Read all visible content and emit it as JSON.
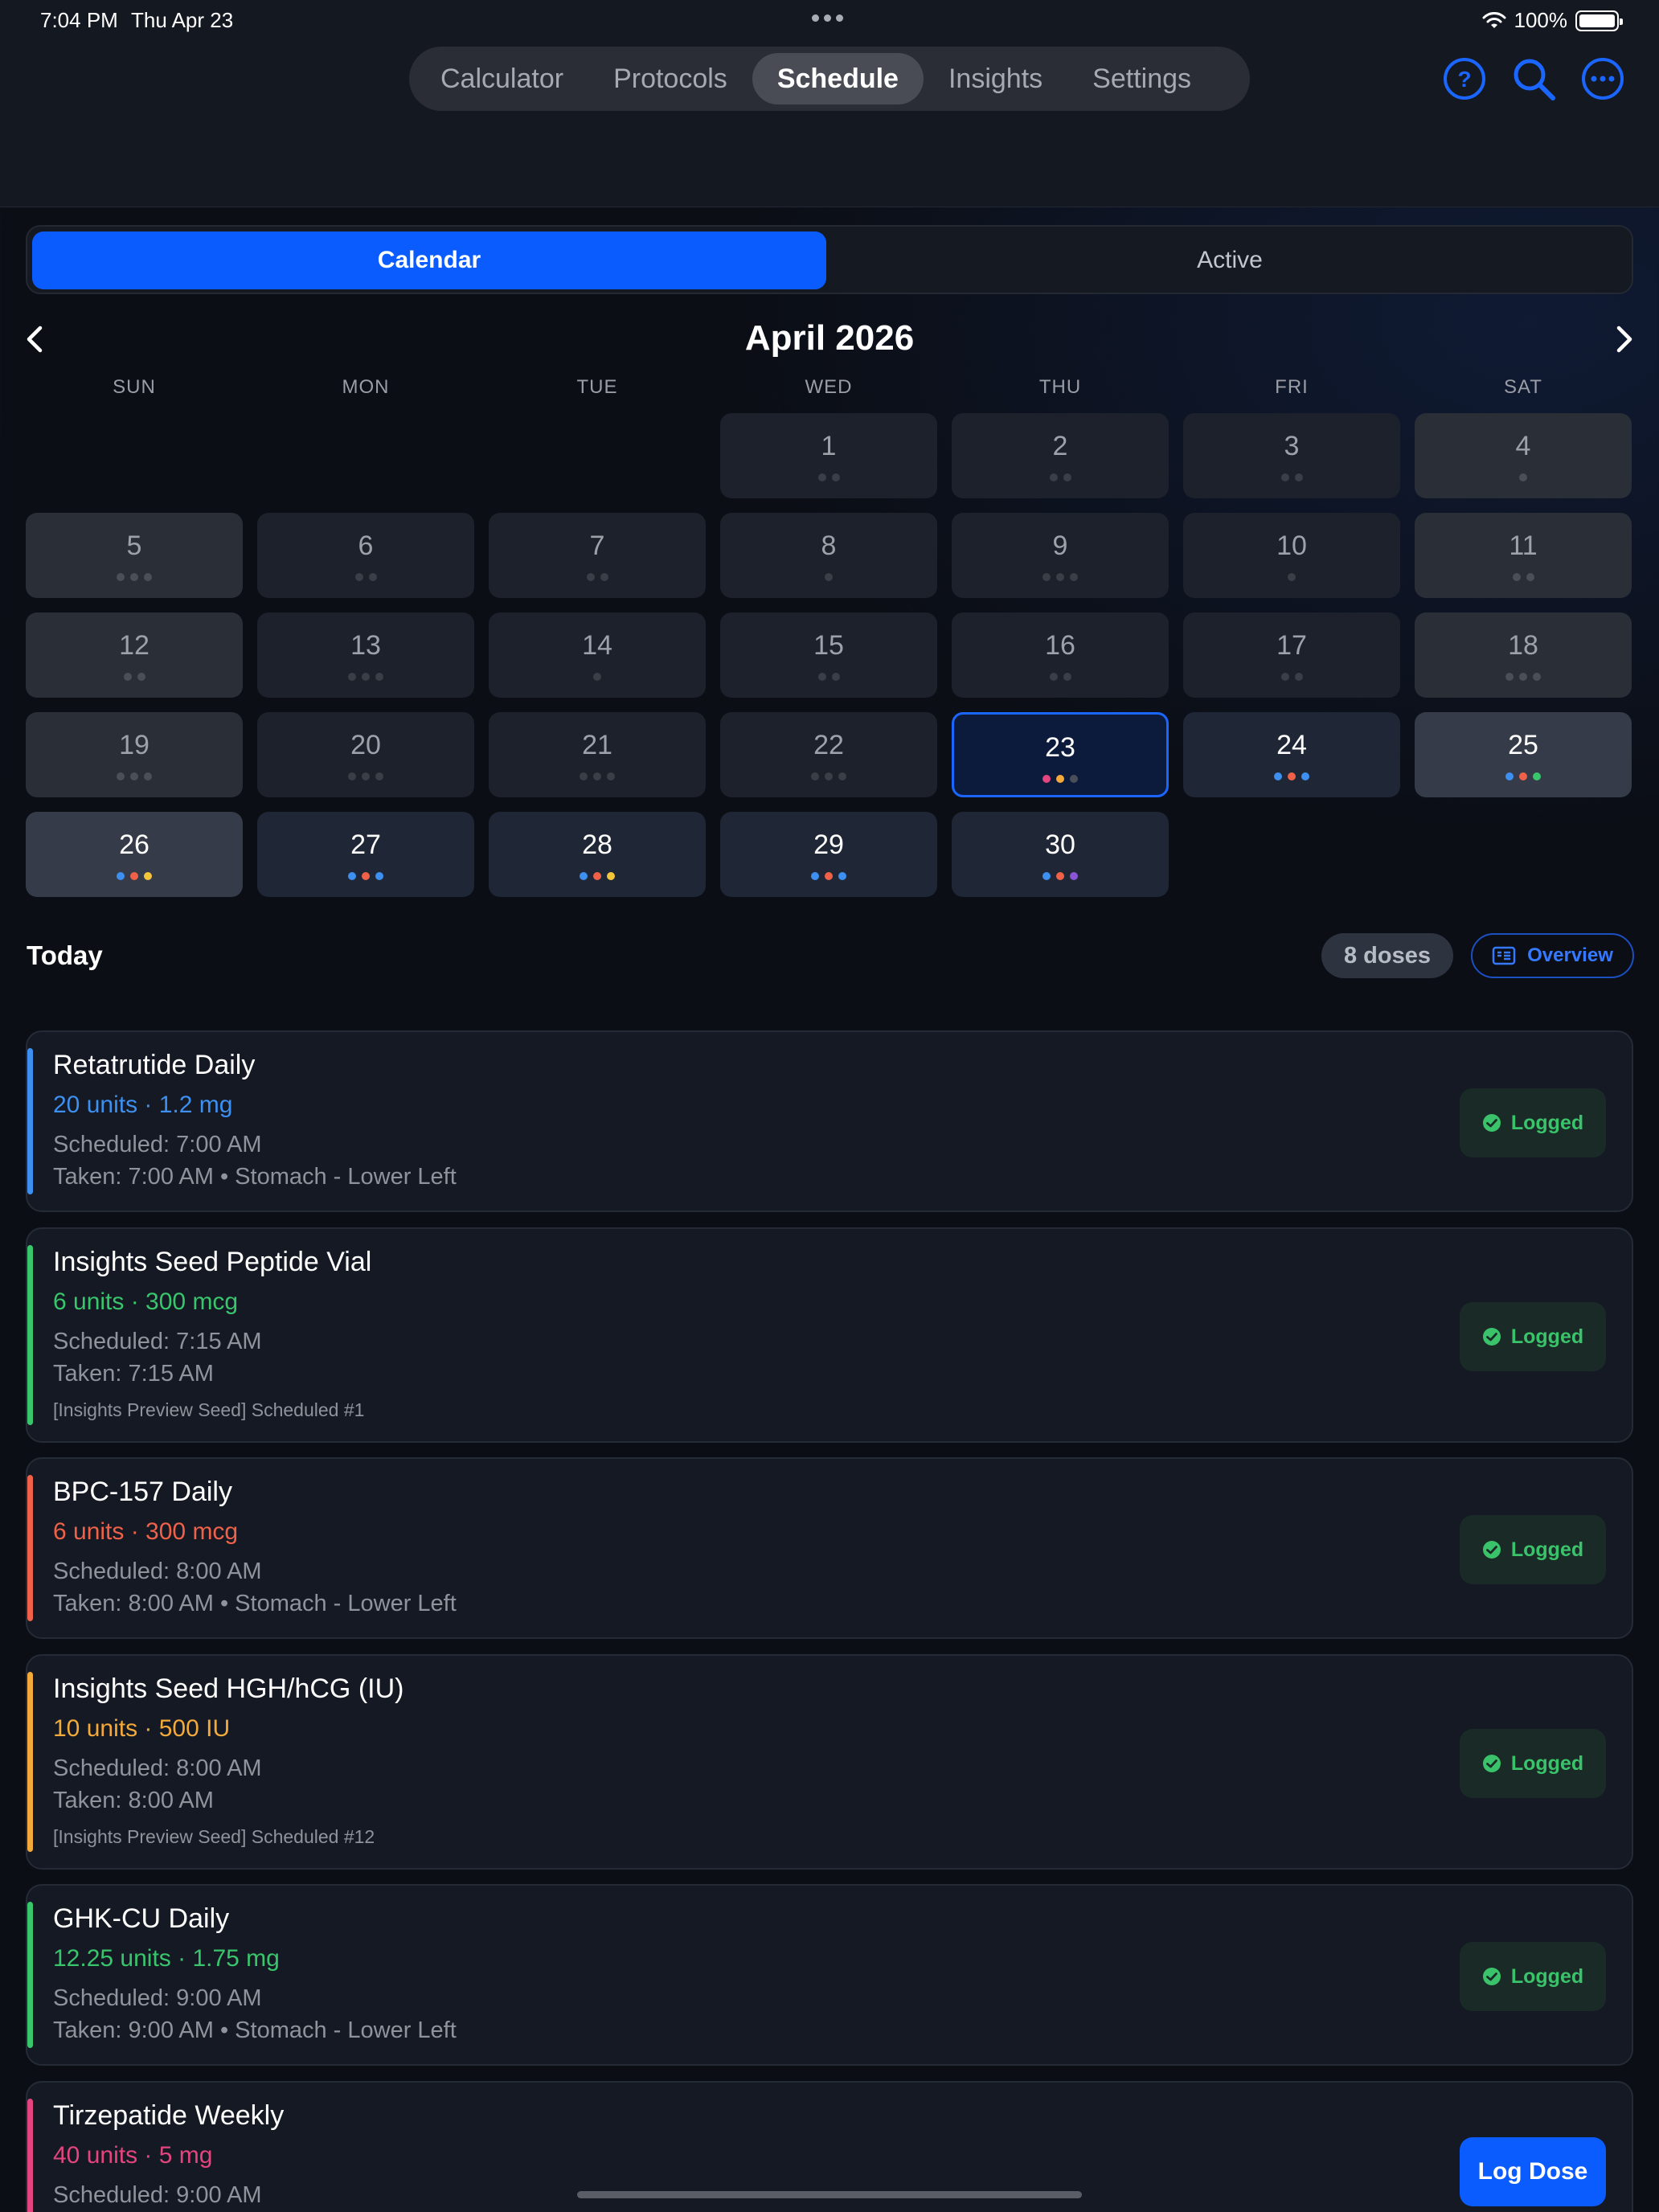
{
  "status_bar": {
    "time": "7:04 PM",
    "date": "Thu Apr 23",
    "battery": "100%",
    "battery_level": 1.0
  },
  "nav": {
    "tabs": [
      {
        "label": "Calculator",
        "active": false
      },
      {
        "label": "Protocols",
        "active": false
      },
      {
        "label": "Schedule",
        "active": true
      },
      {
        "label": "Insights",
        "active": false
      },
      {
        "label": "Settings",
        "active": false
      }
    ],
    "icons": [
      "help-icon",
      "search-icon",
      "more-icon"
    ],
    "accent": "#0a5cff"
  },
  "segment": {
    "calendar": "Calendar",
    "active": "Active",
    "selected": "Calendar"
  },
  "calendar": {
    "month_title": "April 2026",
    "weekdays": [
      "SUN",
      "MON",
      "TUE",
      "WED",
      "THU",
      "FRI",
      "SAT"
    ],
    "today": "23",
    "days": [
      {
        "day": "1",
        "dots": [
          "#3a3e47",
          "#3a3e47"
        ]
      },
      {
        "day": "2",
        "dots": [
          "#3a3e47",
          "#3a3e47"
        ]
      },
      {
        "day": "3",
        "dots": [
          "#3a3e47",
          "#3a3e47"
        ]
      },
      {
        "day": "4",
        "dots": [
          "#4b4f59"
        ]
      },
      {
        "day": "5",
        "dots": [
          "#4b4f59",
          "#4b4f59",
          "#4b4f59"
        ]
      },
      {
        "day": "6",
        "dots": [
          "#3a3e47",
          "#3a3e47"
        ]
      },
      {
        "day": "7",
        "dots": [
          "#3a3e47",
          "#3a3e47"
        ]
      },
      {
        "day": "8",
        "dots": [
          "#3a3e47"
        ]
      },
      {
        "day": "9",
        "dots": [
          "#3a3e47",
          "#3a3e47",
          "#3a3e47"
        ]
      },
      {
        "day": "10",
        "dots": [
          "#3a3e47"
        ]
      },
      {
        "day": "11",
        "dots": [
          "#4b4f59",
          "#4b4f59"
        ]
      },
      {
        "day": "12",
        "dots": [
          "#4b4f59",
          "#4b4f59"
        ]
      },
      {
        "day": "13",
        "dots": [
          "#3a3e47",
          "#3a3e47",
          "#3a3e47"
        ]
      },
      {
        "day": "14",
        "dots": [
          "#3a3e47"
        ]
      },
      {
        "day": "15",
        "dots": [
          "#3a3e47",
          "#3a3e47"
        ]
      },
      {
        "day": "16",
        "dots": [
          "#3a3e47",
          "#3a3e47"
        ]
      },
      {
        "day": "17",
        "dots": [
          "#3a3e47",
          "#3a3e47"
        ]
      },
      {
        "day": "18",
        "dots": [
          "#4b4f59",
          "#4b4f59",
          "#4b4f59"
        ]
      },
      {
        "day": "19",
        "dots": [
          "#4b4f59",
          "#4b4f59",
          "#4b4f59"
        ]
      },
      {
        "day": "20",
        "dots": [
          "#3a3e47",
          "#3a3e47",
          "#3a3e47"
        ]
      },
      {
        "day": "21",
        "dots": [
          "#3a3e47",
          "#3a3e47",
          "#3a3e47"
        ]
      },
      {
        "day": "22",
        "dots": [
          "#3a3e47",
          "#3a3e47",
          "#3a3e47"
        ]
      },
      {
        "day": "23",
        "dots": [
          "#e5457e",
          "#f4a93b",
          "#4a4e58"
        ]
      },
      {
        "day": "24",
        "dots": [
          "#3d8ff0",
          "#ef6148",
          "#3d8ff0"
        ]
      },
      {
        "day": "25",
        "dots": [
          "#3d8ff0",
          "#ef6148",
          "#39c56c"
        ]
      },
      {
        "day": "26",
        "dots": [
          "#3d8ff0",
          "#ef6148",
          "#f4c43b"
        ]
      },
      {
        "day": "27",
        "dots": [
          "#3d8ff0",
          "#ef6148",
          "#3d8ff0"
        ]
      },
      {
        "day": "28",
        "dots": [
          "#3d8ff0",
          "#ef6148",
          "#f4c43b"
        ]
      },
      {
        "day": "29",
        "dots": [
          "#3d8ff0",
          "#ef6148",
          "#3d8ff0"
        ]
      },
      {
        "day": "30",
        "dots": [
          "#3d8ff0",
          "#ef6148",
          "#8a55d6"
        ]
      }
    ]
  },
  "today_section": {
    "title": "Today",
    "dose_count": "8 doses",
    "overview_label": "Overview"
  },
  "doses": [
    {
      "name": "Retatrutide Daily",
      "dose": "20 units · 1.2 mg",
      "color": "#3d8ff0",
      "scheduled": "Scheduled: 7:00 AM",
      "taken": "Taken: 7:00 AM • Stomach - Lower Left",
      "note": "",
      "status": "Logged"
    },
    {
      "name": "Insights Seed Peptide Vial",
      "dose": "6 units · 300 mcg",
      "color": "#39c56c",
      "scheduled": "Scheduled: 7:15 AM",
      "taken": "Taken: 7:15 AM",
      "note": "[Insights Preview Seed] Scheduled #1",
      "status": "Logged"
    },
    {
      "name": "BPC-157 Daily",
      "dose": "6 units · 300 mcg",
      "color": "#ef6148",
      "scheduled": "Scheduled: 8:00 AM",
      "taken": "Taken: 8:00 AM • Stomach - Lower Left",
      "note": "",
      "status": "Logged"
    },
    {
      "name": "Insights Seed HGH/hCG (IU)",
      "dose": "10 units · 500 IU",
      "color": "#f4a93b",
      "scheduled": "Scheduled: 8:00 AM",
      "taken": "Taken: 8:00 AM",
      "note": "[Insights Preview Seed] Scheduled #12",
      "status": "Logged"
    },
    {
      "name": "GHK-CU Daily",
      "dose": "12.25 units · 1.75 mg",
      "color": "#39c56c",
      "scheduled": "Scheduled: 9:00 AM",
      "taken": "Taken: 9:00 AM • Stomach - Lower Left",
      "note": "",
      "status": "Logged"
    },
    {
      "name": "Tirzepatide Weekly",
      "dose": "40 units · 5 mg",
      "color": "#e5457e",
      "scheduled": "Scheduled: 9:00 AM",
      "taken": "",
      "note": "",
      "status": "Log Dose"
    }
  ]
}
